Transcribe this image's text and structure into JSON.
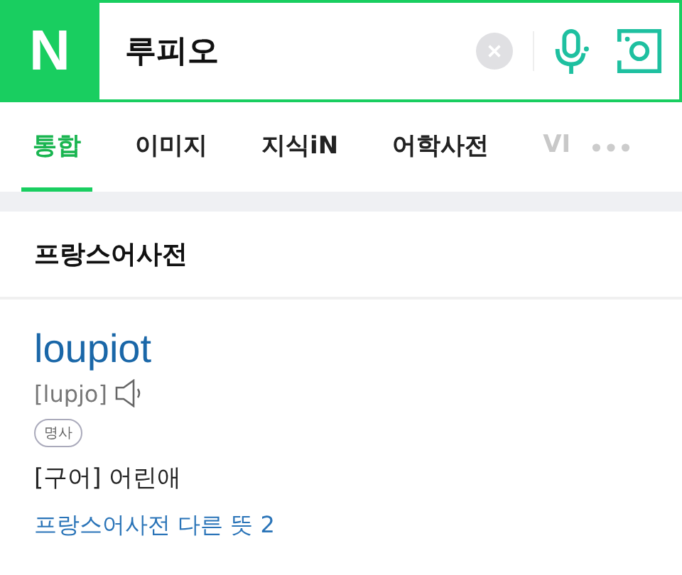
{
  "logo": "N",
  "search": {
    "value": "루피오"
  },
  "tabs": [
    {
      "label": "통합",
      "selected": true
    },
    {
      "label": "이미지",
      "selected": false
    },
    {
      "label": "지식iN",
      "selected": false
    },
    {
      "label": "어학사전",
      "selected": false
    },
    {
      "label": "VI",
      "selected": false
    }
  ],
  "section": {
    "title": "프랑스어사전"
  },
  "entry": {
    "word": "loupiot",
    "pronunciation": "[lupjo]",
    "part_of_speech": "명사",
    "meaning": "[구어] 어린애",
    "more_link": "프랑스어사전 다른 뜻 2"
  }
}
